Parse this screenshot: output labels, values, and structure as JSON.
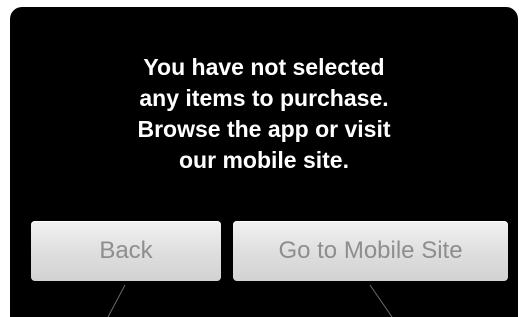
{
  "dialog": {
    "message_lines": [
      "You have not selected",
      "any items to purchase.",
      "Browse the app or visit",
      "our mobile site."
    ]
  },
  "buttons": {
    "back_label": "Back",
    "mobile_site_label": "Go to Mobile Site"
  },
  "colors": {
    "background": "#000000",
    "message_text": "#ffffff",
    "button_face": "#dedede",
    "button_text": "#8e8e8e"
  }
}
